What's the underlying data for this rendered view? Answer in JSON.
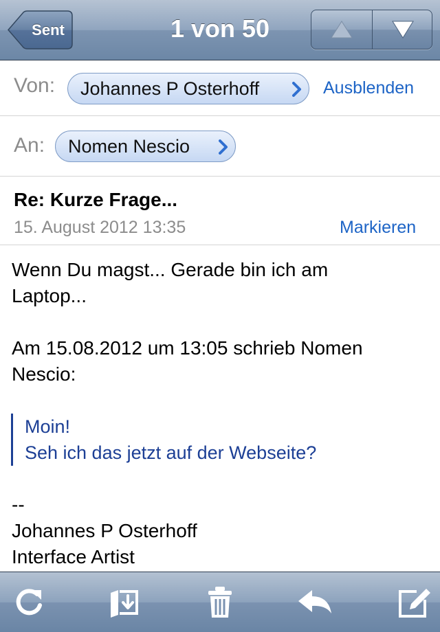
{
  "nav": {
    "back_label": "Sent",
    "title": "1 von 50",
    "prev_icon": "arrow-up-icon",
    "next_icon": "arrow-down-icon"
  },
  "header": {
    "from_label": "Von:",
    "from_name": "Johannes P Osterhoff",
    "hide_link": "Ausblenden",
    "to_label": "An:",
    "to_name": "Nomen Nescio",
    "subject": "Re: Kurze Frage...",
    "date": "15. August 2012 13:35",
    "mark_link": "Markieren"
  },
  "body": {
    "para1_line1": "Wenn Du magst... Gerade bin ich am",
    "para1_line2": "Laptop...",
    "attribution_line1": "Am 15.08.2012 um 13:05 schrieb Nomen",
    "attribution_line2": "Nescio:",
    "quote_line1": "Moin!",
    "quote_line2": "Seh ich das jetzt auf der Webseite?",
    "sig_dash": "--",
    "sig_name": "Johannes P Osterhoff",
    "sig_title": "Interface Artist"
  },
  "toolbar": {
    "items": [
      "refresh-icon",
      "move-to-folder-icon",
      "trash-icon",
      "reply-icon",
      "compose-icon"
    ]
  },
  "colors": {
    "link": "#1d64c6",
    "quote": "#1c3f95",
    "label_gray": "#8c8c8c",
    "bar_blue": "#6c87a6"
  }
}
